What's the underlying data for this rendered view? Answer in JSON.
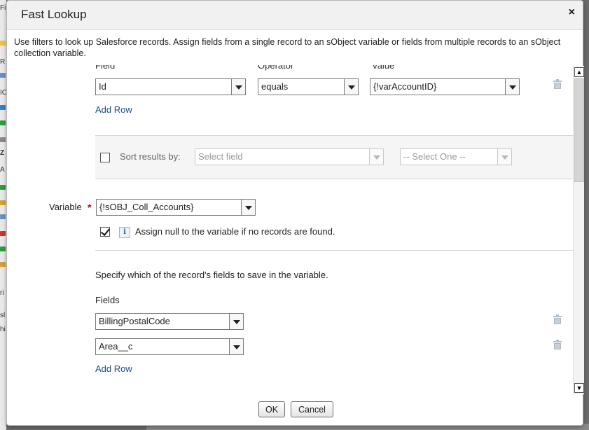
{
  "dialog": {
    "title": "Fast Lookup",
    "close_glyph": "×",
    "intro": "Use filters to look up Salesforce records. Assign fields from a single record to an sObject variable or fields from multiple records to an sObject collection variable."
  },
  "filters": {
    "headers": {
      "field": "Field",
      "operator": "Operator",
      "value": "Value"
    },
    "rows": [
      {
        "field": "Id",
        "operator": "equals",
        "value": "{!varAccountID}"
      }
    ],
    "add_row": "Add Row"
  },
  "sort": {
    "label": "Sort results by:",
    "field_placeholder": "Select field",
    "order_placeholder": "-- Select One --",
    "checked": false
  },
  "variable": {
    "label": "Variable",
    "required_mark": "*",
    "value": "{!sOBJ_Coll_Accounts}",
    "assign_null_label": "Assign null to the variable if no records are found.",
    "assign_null_checked": true,
    "info_glyph": "i"
  },
  "fields_section": {
    "instruction": "Specify which of the record's fields to save in the variable.",
    "label": "Fields",
    "items": [
      "BillingPostalCode",
      "Area__c"
    ],
    "add_row": "Add Row"
  },
  "footer": {
    "ok": "OK",
    "cancel": "Cancel"
  },
  "scrollbar": {
    "up_glyph": "▲",
    "down_glyph": "▼"
  },
  "background": {
    "letters": [
      "Fi",
      "R",
      "IC",
      "Z",
      "A",
      "ri",
      "sl",
      "hi"
    ]
  },
  "colors": {
    "link": "#1a4c8b",
    "required": "#cc0000",
    "header_bg": "#f1f1f1"
  },
  "icons": [
    "close-icon",
    "trash-icon",
    "info-icon",
    "chevron-down-icon",
    "checkbox-icon",
    "scroll-up-icon",
    "scroll-down-icon"
  ]
}
